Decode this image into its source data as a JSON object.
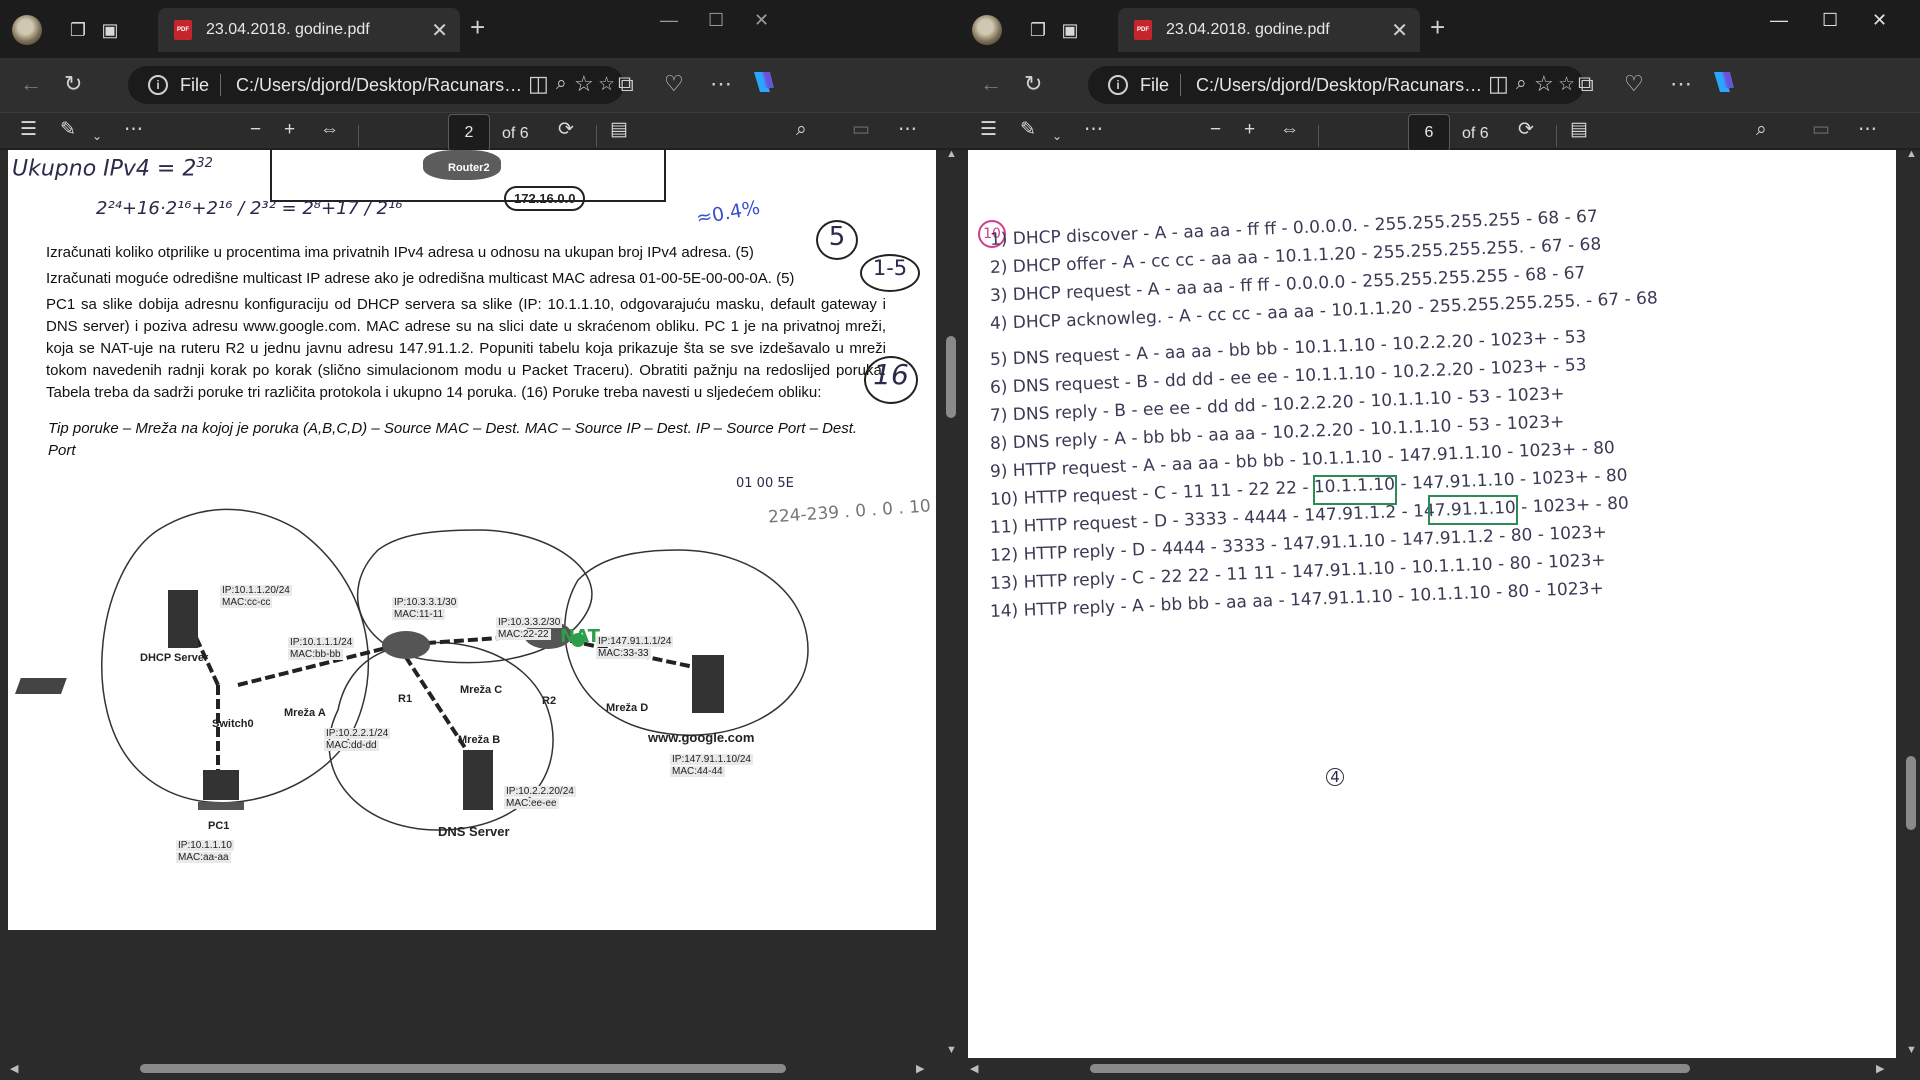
{
  "left": {
    "tab_title": "23.04.2018. godine.pdf",
    "address_scheme": "File",
    "address_url": "C:/Users/djord/Desktop/Racunarsk...",
    "page_number": "2",
    "page_total": "of 6",
    "document": {
      "note_top": "Ukupno IPv4 = 2",
      "note_top_exp": "32",
      "note_fraction": "2²⁴+16·2¹⁶+2¹⁶ / 2³² = 2⁸+17 / 2¹⁶",
      "note_percent": "≈0.4%",
      "router_label": "Router2",
      "router_ip": "172.16.0.0",
      "q8": "Izračunati koliko otprilike u procentima ima privatnih IPv4 adresa u odnosu na ukupan broj IPv4 adresa. (5)",
      "q9": "Izračunati moguće odredišne multicast IP adrese ako je odredišna multicast MAC adresa 01-00-5E-00-00-0A. (5)",
      "q10": "PC1 sa slike dobija adresnu konfiguraciju od DHCP servera sa slike (IP: 10.1.1.10, odgovarajuću masku, default gateway i DNS server) i poziva adresu www.google.com. MAC adrese su na slici date u skraćenom obliku. PC 1 je na privatnoj mreži, koja se NAT-uje na ruteru R2 u jednu javnu adresu 147.91.1.2. Popuniti tabelu koja prikazuje šta se sve izdešavalo u mreži tokom navedenih radnji korak po korak (slično simulacionom modu u Packet Traceru). Obratiti pažnju na redoslijed poruka. Tabela treba da sadrži poruke tri različita protokola i ukupno 14 poruka. (16) Poruke treba navesti u sljedećem obliku:",
      "format_line": "Tip poruke – Mreža na kojoj je poruka (A,B,C,D) – Source MAC – Dest. MAC – Source IP – Dest. IP – Source Port – Dest. Port",
      "score_5a": "5",
      "score_range": "1-5",
      "score_16": "16",
      "margin_note1": "01 00 5E",
      "margin_note2": "224-239 . 0 . 0 . 10",
      "nat_note": "NAT",
      "diagram": {
        "dhcp_label": "DHCP Server",
        "dhcp_ip": "IP:10.1.1.20/24",
        "dhcp_mac": "MAC:cc-cc",
        "switch_label": "Switch0",
        "r1_label": "R1",
        "r1_a_ip": "IP:10.1.1.1/24",
        "r1_a_mac": "MAC:bb-bb",
        "r1_c_ip": "IP:10.3.3.1/30",
        "r1_c_mac": "MAC:11-11",
        "r1_b_ip": "IP:10.2.2.1/24",
        "r1_b_mac": "MAC:dd-dd",
        "r2_label": "R2",
        "r2_c_ip": "IP:10.3.3.2/30",
        "r2_c_mac": "MAC:22-22",
        "r2_d_ip": "IP:147.91.1.1/24",
        "r2_d_mac": "MAC:33-33",
        "net_a": "Mreža A",
        "net_b": "Mreža B",
        "net_c": "Mreža C",
        "net_d": "Mreža D",
        "google_label": "www.google.com",
        "google_ip": "IP:147.91.1.10/24",
        "google_mac": "MAC:44-44",
        "dns_label": "DNS Server",
        "dns_ip": "IP:10.2.2.20/24",
        "dns_mac": "MAC:ee-ee",
        "pc_label": "PC1",
        "pc_ip": "IP:10.1.1.10",
        "pc_mac": "MAC:aa-aa"
      }
    }
  },
  "right": {
    "tab_title": "23.04.2018. godine.pdf",
    "address_scheme": "File",
    "address_url": "C:/Users/djord/Desktop/Racunarsk...",
    "page_number": "6",
    "page_total": "of 6",
    "document": {
      "task_number": "10",
      "page_footer": "4",
      "lines": [
        "1) DHCP discover - A - aa aa - ff ff - 0.0.0.0. - 255.255.255.255 - 68 - 67",
        "2) DHCP offer - A - cc cc - aa aa - 10.1.1.20 - 255.255.255.255. - 67 - 68",
        "3) DHCP request - A - aa aa - ff ff - 0.0.0.0 - 255.255.255.255 - 68 - 67",
        "4) DHCP acknowleg. - A - cc cc - aa aa - 10.1.1.20 - 255.255.255.255. - 67 - 68",
        "5) DNS request - A - aa aa - bb bb - 10.1.1.10 - 10.2.2.20 - 1023+ - 53",
        "6) DNS request - B - dd dd - ee ee - 10.1.1.10 - 10.2.2.20 - 1023+ - 53",
        "7) DNS reply - B - ee ee - dd dd - 10.2.2.20 - 10.1.1.10 - 53 - 1023+",
        "8) DNS reply - A - bb bb - aa aa - 10.2.2.20 - 10.1.1.10 - 53 - 1023+",
        "9) HTTP request - A - aa aa - bb bb - 10.1.1.10 - 147.91.1.10 - 1023+ - 80",
        "10) HTTP request - C - 11 11 - 22 22 - 10.1.1.10 - 147.91.1.10 - 1023+ - 80",
        "11) HTTP request - D - 3333 - 4444 - 147.91.1.2 - 147.91.1.10 - 1023+ - 80",
        "12) HTTP reply - D - 4444 - 3333 - 147.91.1.10 - 147.91.1.2 - 80 - 1023+",
        "13) HTTP reply - C - 22 22 - 11 11 - 147.91.1.10 - 10.1.1.10 - 80 - 1023+",
        "14) HTTP reply - A - bb bb - aa aa - 147.91.1.10 - 10.1.1.10 - 80 - 1023+"
      ]
    }
  }
}
